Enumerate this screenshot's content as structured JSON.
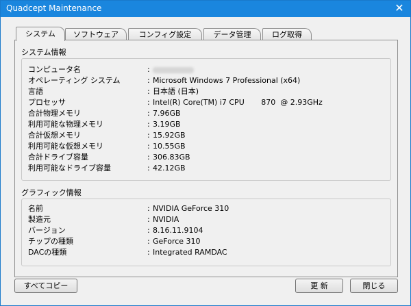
{
  "window": {
    "title": "Quadcept Maintenance",
    "close_glyph": "✕"
  },
  "tabs": [
    {
      "label": "システム",
      "active": true
    },
    {
      "label": "ソフトウェア",
      "active": false
    },
    {
      "label": "コンフィグ設定",
      "active": false
    },
    {
      "label": "データ管理",
      "active": false
    },
    {
      "label": "ログ取得",
      "active": false
    }
  ],
  "system_info": {
    "heading": "システム情報",
    "rows": [
      {
        "label": "コンピュータ名",
        "value": ""
      },
      {
        "label": "オペレーティング システム",
        "value": "Microsoft Windows 7 Professional (x64)"
      },
      {
        "label": "言語",
        "value": "日本語 (日本)"
      },
      {
        "label": "プロセッサ",
        "value": "Intel(R) Core(TM) i7 CPU       870  @ 2.93GHz"
      },
      {
        "label": "合計物理メモリ",
        "value": "7.96GB"
      },
      {
        "label": "利用可能な物理メモリ",
        "value": "3.19GB"
      },
      {
        "label": "合計仮想メモリ",
        "value": "15.92GB"
      },
      {
        "label": "利用可能な仮想メモリ",
        "value": "10.55GB"
      },
      {
        "label": "合計ドライブ容量",
        "value": "306.83GB"
      },
      {
        "label": "利用可能なドライブ容量",
        "value": "42.12GB"
      }
    ]
  },
  "graphics_info": {
    "heading": "グラフィック情報",
    "rows": [
      {
        "label": "名前",
        "value": "NVIDIA GeForce 310"
      },
      {
        "label": "製造元",
        "value": "NVIDIA"
      },
      {
        "label": "バージョン",
        "value": "8.16.11.9104"
      },
      {
        "label": "チップの種類",
        "value": "GeForce 310"
      },
      {
        "label": "DACの種類",
        "value": "Integrated RAMDAC"
      }
    ]
  },
  "separator": ":",
  "buttons": {
    "copy_all": "すべてコピー",
    "refresh": "更 新",
    "close": "閉じる"
  }
}
